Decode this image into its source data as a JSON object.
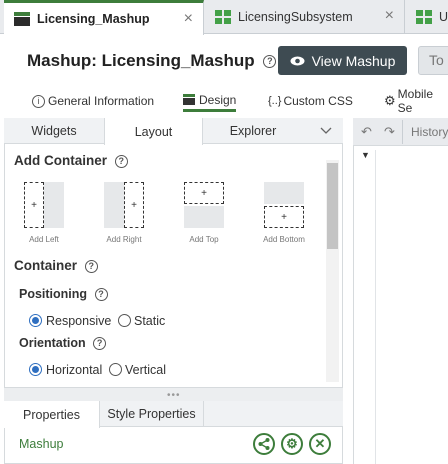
{
  "tabs": [
    {
      "label": "Licensing_Mashup",
      "active": true
    },
    {
      "label": "LicensingSubsystem",
      "active": false
    },
    {
      "label": "Us",
      "active": false
    }
  ],
  "header": {
    "title": "Mashup: Licensing_Mashup",
    "view_button": "View Mashup",
    "to_button": "To"
  },
  "subtabs": [
    "General Information",
    "Design",
    "Custom CSS",
    "Mobile Se"
  ],
  "panel_tabs": [
    "Widgets",
    "Layout",
    "Explorer"
  ],
  "add_container": {
    "heading": "Add Container",
    "items": [
      "Add Left",
      "Add Right",
      "Add Top",
      "Add Bottom"
    ]
  },
  "container": {
    "heading": "Container",
    "positioning_label": "Positioning",
    "positioning_options": [
      "Responsive",
      "Static"
    ],
    "orientation_label": "Orientation",
    "orientation_options": [
      "Horizontal",
      "Vertical"
    ]
  },
  "bottom_tabs": [
    "Properties",
    "Style Properties"
  ],
  "selected_widget": "Mashup",
  "history": {
    "label": "History"
  },
  "colors": {
    "accent": "#3d7d3b",
    "dark_button": "#3e4b52",
    "radio": "#2f6fc0"
  }
}
